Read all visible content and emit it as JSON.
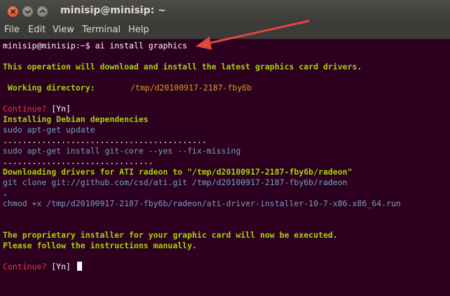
{
  "window": {
    "title": "minisip@minisip: ~"
  },
  "menu": [
    "File",
    "Edit",
    "View",
    "Terminal",
    "Help"
  ],
  "terminal": {
    "prompt": "minisip@minisip:~$ ",
    "command": "ai install graphics",
    "intro": "This operation will download and install the latest graphics card drivers.",
    "workdir_label": " Working directory:",
    "workdir_value": "/tmp/d20100917-2187-fby6b",
    "continue_label": "Continue?",
    "continue_options": " [Yn]",
    "dependencies_heading": "Installing Debian dependencies",
    "cmd_update": "sudo apt-get update",
    "dots_1": "..........................................",
    "cmd_install": "sudo apt-get install git-core --yes --fix-missing",
    "dots_2": "...............................",
    "downloading": "Downloading drivers for ATI radeon to \"/tmp/d20100917-2187-fby6b/radeon\"",
    "cmd_clone": "git clone git://github.com/csd/ati.git /tmp/d20100917-2187-fby6b/radeon",
    "dot_single": ".",
    "cmd_chmod": "chmod +x /tmp/d20100917-2187-fby6b/radeon/ati-driver-installer-10-7-x86.x86_64.run",
    "installer_note_1": "The proprietary installer for your graphic card will now be executed.",
    "installer_note_2": "Please follow the instructions manually.",
    "continue_label_2": "Continue?",
    "continue_options_2": " [Yn] "
  },
  "annotation": {
    "arrow_color": "#e0483c"
  }
}
